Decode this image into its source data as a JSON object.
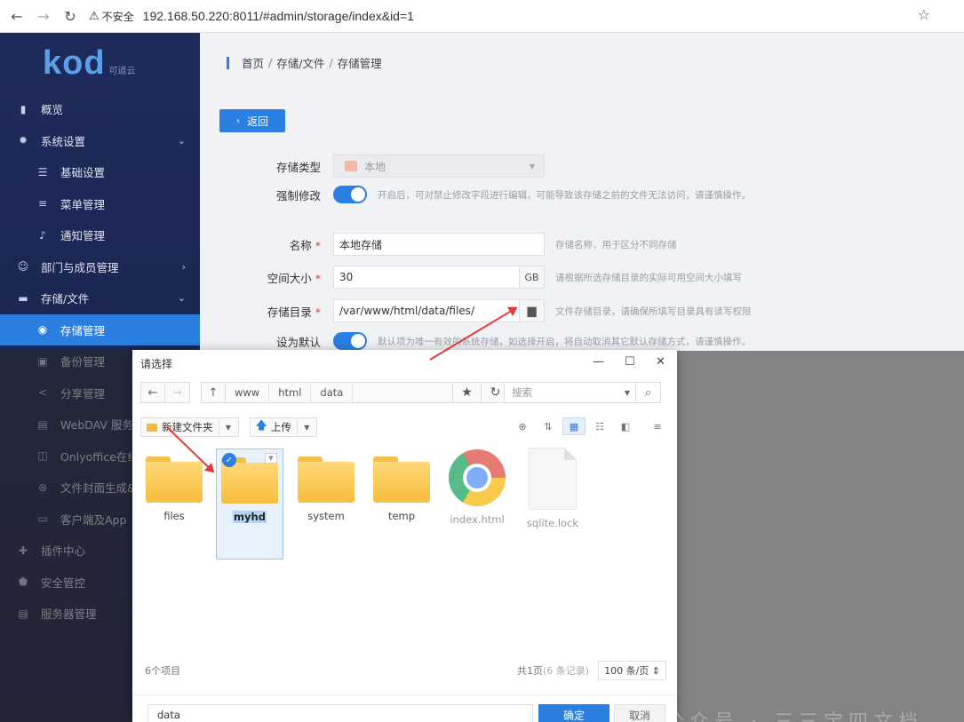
{
  "browser": {
    "warning": "不安全",
    "url": "192.168.50.220:8011/#admin/storage/index&id=1"
  },
  "logo": {
    "brand": "kod",
    "sub": "可道云"
  },
  "sidebar": {
    "items": [
      {
        "label": "概览",
        "icon": "chart-bar-icon",
        "level": 0
      },
      {
        "label": "系统设置",
        "icon": "gear-icon",
        "level": 0,
        "chevron": "down"
      },
      {
        "label": "基础设置",
        "icon": "sliders-icon",
        "level": 1
      },
      {
        "label": "菜单管理",
        "icon": "list-icon",
        "level": 1
      },
      {
        "label": "通知管理",
        "icon": "bell-icon",
        "level": 1
      },
      {
        "label": "部门与成员管理",
        "icon": "users-icon",
        "level": 0,
        "chevron": "right"
      },
      {
        "label": "存储/文件",
        "icon": "folder-icon",
        "level": 0,
        "chevron": "down"
      },
      {
        "label": "存储管理",
        "icon": "database-icon",
        "level": 1,
        "active": true
      },
      {
        "label": "备份管理",
        "icon": "save-icon",
        "level": 1
      },
      {
        "label": "分享管理",
        "icon": "share-icon",
        "level": 1
      },
      {
        "label": "WebDAV 服务",
        "icon": "server-icon",
        "level": 1
      },
      {
        "label": "Onlyoffice在线",
        "icon": "office-icon",
        "level": 1
      },
      {
        "label": "文件封面生成&",
        "icon": "aperture-icon",
        "level": 1
      },
      {
        "label": "客户端及App",
        "icon": "monitor-icon",
        "level": 1
      },
      {
        "label": "插件中心",
        "icon": "plugin-icon",
        "level": 0
      },
      {
        "label": "安全管控",
        "icon": "shield-icon",
        "level": 0
      },
      {
        "label": "服务器管理",
        "icon": "server-rack-icon",
        "level": 0
      }
    ]
  },
  "breadcrumb": [
    "首页",
    "存储/文件",
    "存储管理"
  ],
  "back_label": "返回",
  "form": {
    "type_label": "存储类型",
    "type_value": "本地",
    "force_label": "强制修改",
    "force_hint": "开启后，可对禁止修改字段进行编辑，可能导致该存储之前的文件无法访问，请谨慎操作。",
    "name_label": "名称",
    "name_value": "本地存储",
    "name_hint": "存储名称，用于区分不同存储",
    "size_label": "空间大小",
    "size_value": "30",
    "size_unit": "GB",
    "size_hint": "请根据所选存储目录的实际可用空间大小填写",
    "dir_label": "存储目录",
    "dir_value": "/var/www/html/data/files/",
    "dir_hint": "文件存储目录，请确保所填写目录具有读写权限",
    "default_label": "设为默认",
    "default_hint": "默认项为唯一有效的系统存储，如选择开启，将自动取消其它默认存储方式，请谨慎操作。"
  },
  "dialog": {
    "title": "请选择",
    "path": [
      "www",
      "html",
      "data"
    ],
    "search_placeholder": "搜索",
    "new_folder": "新建文件夹",
    "upload": "上传",
    "files": [
      {
        "name": "files",
        "kind": "folder"
      },
      {
        "name": "myhd",
        "kind": "folder",
        "selected": true
      },
      {
        "name": "system",
        "kind": "folder"
      },
      {
        "name": "temp",
        "kind": "folder"
      },
      {
        "name": "index.html",
        "kind": "chrome"
      },
      {
        "name": "sqlite.lock",
        "kind": "doc"
      }
    ],
    "count": "6个项目",
    "pages": "共1页",
    "records": "(6 条记录)",
    "page_size": "100 条/页",
    "input_value": "data",
    "ok": "确定",
    "cancel": "取消"
  },
  "watermark": "公众号 · 三三宝四文档"
}
